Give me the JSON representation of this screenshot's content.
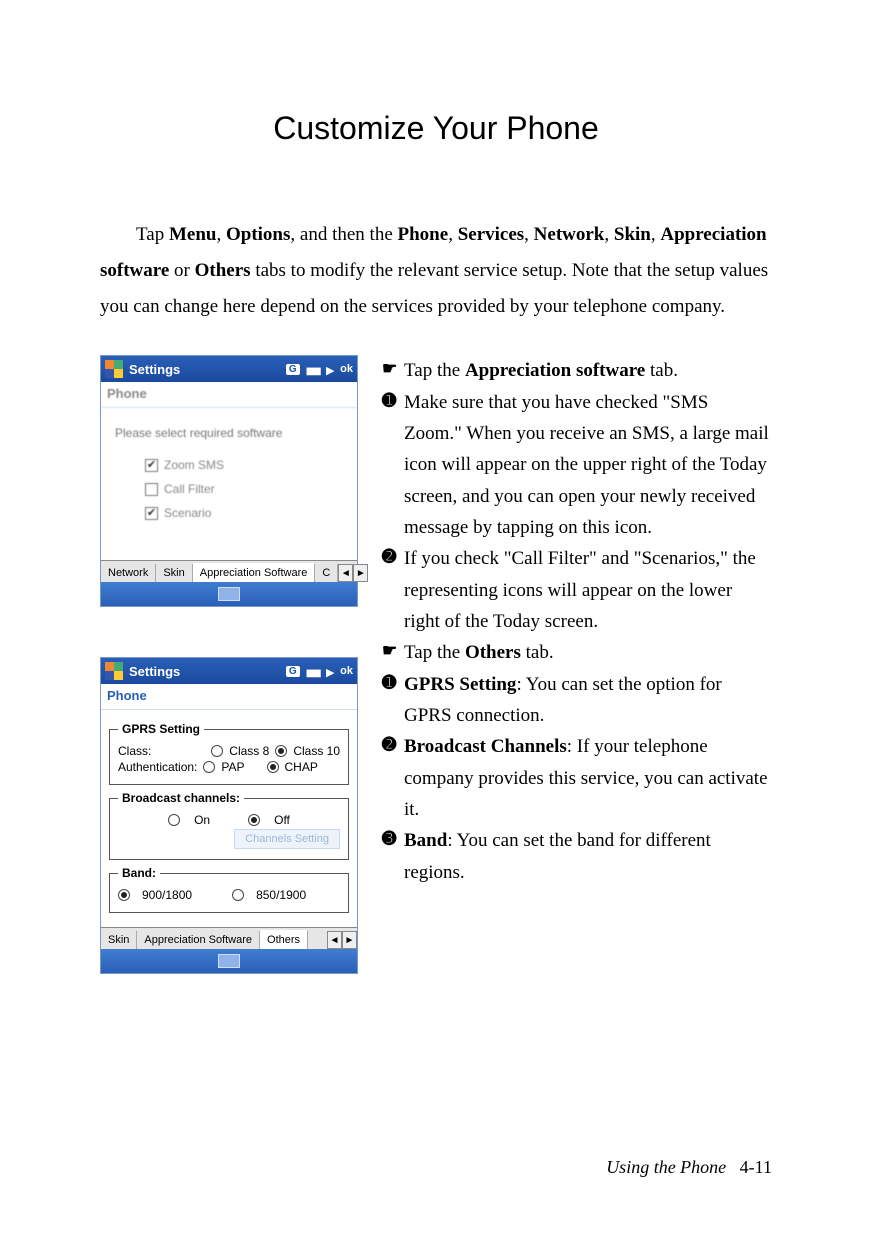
{
  "title": "Customize Your Phone",
  "intro_parts": {
    "t1": "Tap ",
    "b1": "Menu",
    "t2": ", ",
    "b2": "Options",
    "t3": ", and then the ",
    "b3": "Phone",
    "t4": ", ",
    "b4": "Services",
    "t5": ", ",
    "b5": "Network",
    "t6": ", ",
    "b6": "Skin",
    "t7": ", ",
    "b7": "Appreciation software",
    "t8": " or ",
    "b8": "Others",
    "t9": " tabs to modify the relevant service setup. Note that the setup values you can change here depend on the services provided by your telephone company."
  },
  "shot1": {
    "title": "Settings",
    "status_letter": "G",
    "ok": "ok",
    "subheader": "Phone",
    "prompt": "Please select required software",
    "items": [
      {
        "label": "Zoom SMS",
        "checked": true
      },
      {
        "label": "Call Filter",
        "checked": false
      },
      {
        "label": "Scenario",
        "checked": true
      }
    ],
    "tabs": {
      "network": "Network",
      "skin": "Skin",
      "appr": "Appreciation Software",
      "extra": "C"
    }
  },
  "shot2": {
    "title": "Settings",
    "status_letter": "G",
    "ok": "ok",
    "subheader": "Phone",
    "gprs": {
      "legend": "GPRS Setting",
      "class_label": "Class:",
      "class8": "Class 8",
      "class10": "Class 10",
      "auth_label": "Authentication:",
      "pap": "PAP",
      "chap": "CHAP"
    },
    "broadcast": {
      "legend": "Broadcast channels:",
      "on": "On",
      "off": "Off",
      "button": "Channels Setting"
    },
    "band": {
      "legend": "Band:",
      "opt1": "900/1800",
      "opt2": "850/1900"
    },
    "tabs": {
      "skin": "Skin",
      "appr": "Appreciation Software",
      "others": "Others"
    }
  },
  "right": {
    "r1a": " Tap the ",
    "r1b": "Appreciation software",
    "r1c": " tab.",
    "n1": "➊",
    "r2": "Make sure that you have checked \"SMS Zoom.\" When you receive an SMS, a large mail icon will appear on the upper right of the Today screen, and you can open your newly received message by tapping on this icon.",
    "n2": "➋",
    "r3": "If you check \"Call Filter\" and \"Scenarios,\" the representing icons will appear on the lower right of the Today screen.",
    "r4a": " Tap the ",
    "r4b": "Others",
    "r4c": " tab.",
    "n1b": "➊",
    "r5a": "GPRS Setting",
    "r5b": ": You can set the option for GPRS connection.",
    "n2b": "➋",
    "r6a": "Broadcast Channels",
    "r6b": ": If your telephone company provides this service, you can activate it.",
    "n3": "➌",
    "r7a": "Band",
    "r7b": ": You can set the band for different regions."
  },
  "footer": {
    "section": "Using the Phone",
    "page": "4-11"
  }
}
